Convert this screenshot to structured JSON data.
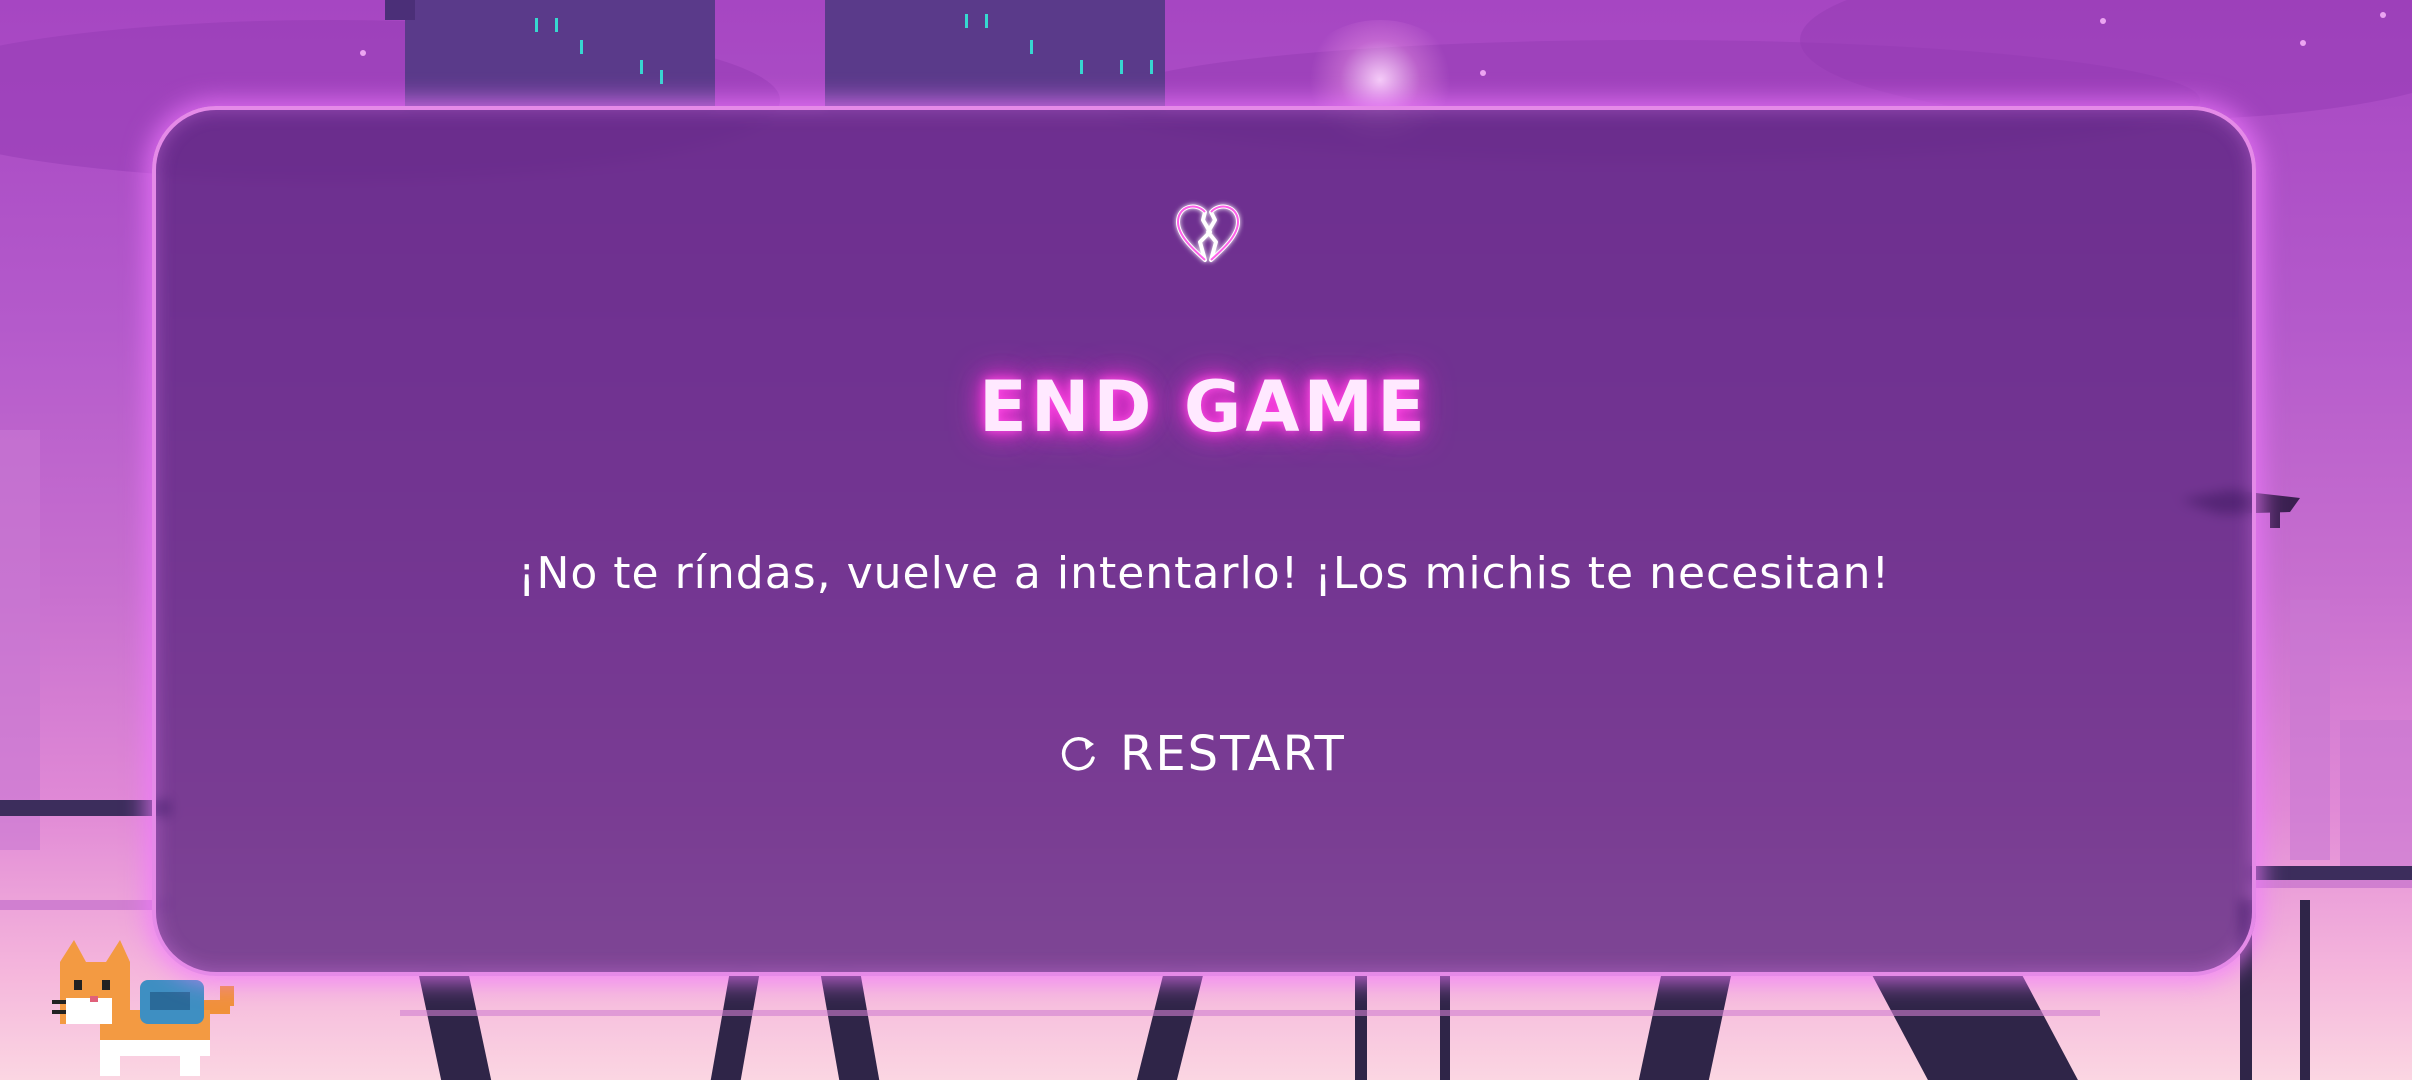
{
  "game_over": {
    "title": "END GAME",
    "message": "¡No te ríndas, vuelve a intentarlo! ¡Los michis te necesitan!",
    "restart_label": "RESTART",
    "icon": "broken-heart-icon",
    "restart_icon": "refresh-icon"
  },
  "colors": {
    "accent": "#ff2fd8",
    "panel_border": "#e58ae8",
    "panel_bg": "#5c2680",
    "text": "#ffffff",
    "window_lights": "#37d7d0"
  }
}
